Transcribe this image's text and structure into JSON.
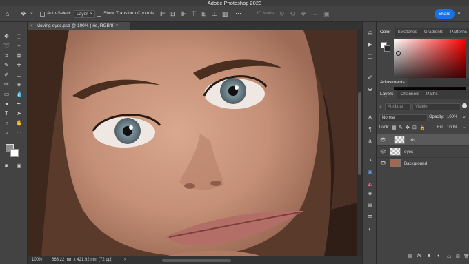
{
  "app": {
    "title": "Adobe Photoshop 2023"
  },
  "options_bar": {
    "auto_select_label": "Auto-Select:",
    "auto_select_value": "Layer",
    "show_transform_label": "Show Transform Controls",
    "mode_3d_label": "3D Mode:",
    "share_label": "Share"
  },
  "document": {
    "tab_title": "Moving-eyes.psd @ 100% (Iris, RGB/8) *",
    "zoom": "100%",
    "doc_size": "663.22 mm x 421.92 mm (72 ppi)"
  },
  "color_panel": {
    "tabs": [
      "Color",
      "Swatches",
      "Gradients",
      "Patterns"
    ],
    "active_tab": "Color"
  },
  "adjustments_panel": {
    "title": "Adjustments"
  },
  "layers_panel": {
    "tabs": [
      "Layers",
      "Channels",
      "Paths"
    ],
    "filter_placeholder": "Attribute",
    "filter_value": "Visible",
    "blend_mode": "Normal",
    "opacity_label": "Opacity:",
    "opacity_value": "100%",
    "lock_label": "Lock:",
    "fill_label": "Fill:",
    "fill_value": "100%",
    "layers": [
      {
        "name": "Iris",
        "selected": true
      },
      {
        "name": "eyes",
        "selected": false
      },
      {
        "name": "Background",
        "selected": false
      }
    ],
    "bottom_icons": [
      "link-icon",
      "fx-icon",
      "mask-icon",
      "adjustment-icon",
      "group-icon",
      "new-layer-icon",
      "trash-icon"
    ]
  },
  "colors": {
    "accent": "#1473e6",
    "ui_bg": "#434343"
  }
}
